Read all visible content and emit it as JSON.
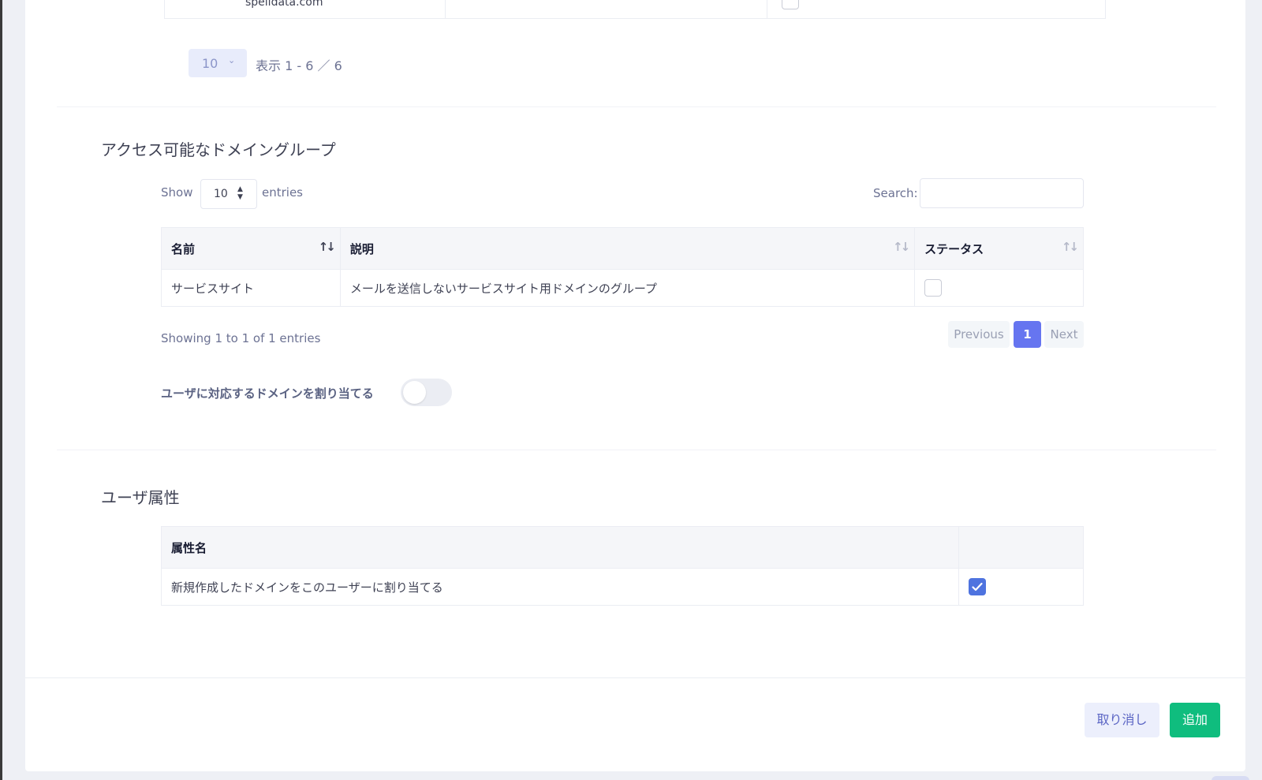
{
  "top_table": {
    "row_name": "spelldata.com"
  },
  "top_pager": {
    "page_size": "10",
    "info": "表示 1 - 6 ／ 6"
  },
  "domain_groups": {
    "title": "アクセス可能なドメイングループ",
    "show_label": "Show",
    "entries_label": "entries",
    "page_length": "10",
    "search_label": "Search:",
    "search_value": "",
    "columns": [
      "名前",
      "説明",
      "ステータス"
    ],
    "rows": [
      {
        "name": "サービスサイト",
        "description": "メールを送信しないサービスサイト用ドメインのグループ",
        "status_checked": false
      }
    ],
    "showing": "Showing 1 to 1 of 1 entries",
    "pagination": {
      "previous": "Previous",
      "current": "1",
      "next": "Next"
    },
    "toggle_label": "ユーザに対応するドメインを割り当てる",
    "toggle_on": false
  },
  "user_attributes": {
    "title": "ユーザ属性",
    "columns": [
      "属性名",
      ""
    ],
    "rows": [
      {
        "name": "新規作成したドメインをこのユーザーに割り当てる",
        "checked": true
      }
    ]
  },
  "footer": {
    "cancel_label": "取り消し",
    "add_label": "追加"
  },
  "colors": {
    "primary": "#6675f0",
    "success": "#0fbd7e",
    "checkbox": "#4e73df"
  }
}
